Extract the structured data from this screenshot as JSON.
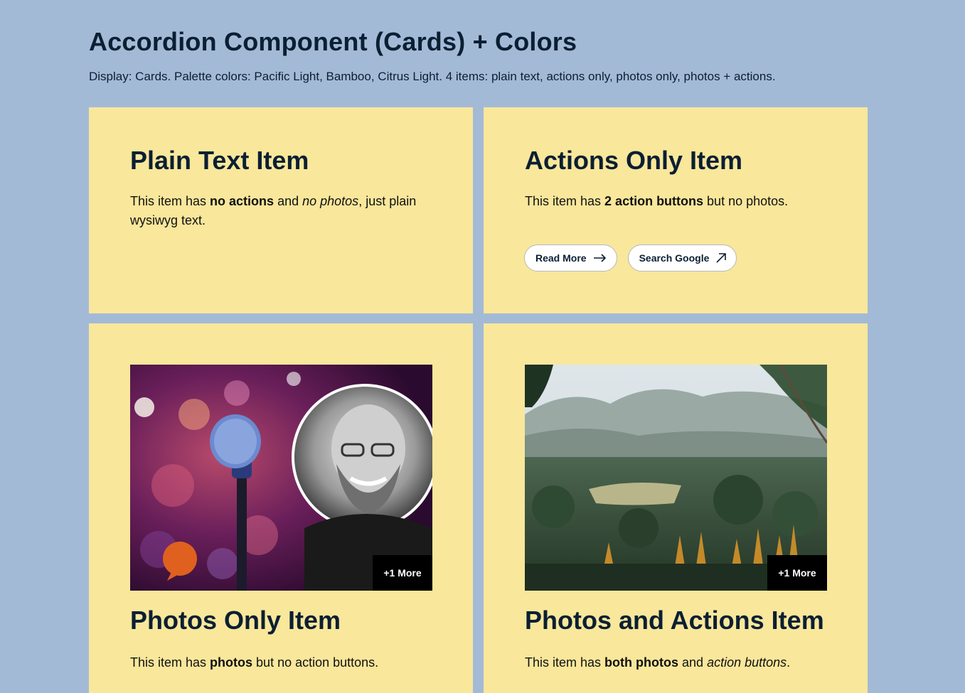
{
  "page": {
    "title": "Accordion Component (Cards) + Colors",
    "description": "Display: Cards. Palette colors: Pacific Light, Bamboo, Citrus Light. 4 items: plain text, actions only, photos only, photos + actions."
  },
  "colors": {
    "background": "#a3bad7",
    "card": "#f9e79b",
    "text": "#0b1f33",
    "badge": "#000000",
    "accent_orange": "#e0601f"
  },
  "cards": [
    {
      "title": "Plain Text Item",
      "body": {
        "p1": "This item has ",
        "b1": "no actions",
        "p2": " and ",
        "i1": "no photos",
        "p3": ", just plain wysiwyg text."
      }
    },
    {
      "title": "Actions Only Item",
      "body": {
        "p1": "This item has ",
        "b1": "2 action buttons",
        "p2": " but no photos."
      },
      "actions": [
        {
          "label": "Read More",
          "icon": "arrow-right-icon"
        },
        {
          "label": "Search Google",
          "icon": "external-link-icon"
        }
      ]
    },
    {
      "title": "Photos Only Item",
      "photo_badge": "+1 More",
      "body": {
        "p1": "This item has ",
        "b1": "photos",
        "p2": " but no action buttons."
      }
    },
    {
      "title": "Photos and Actions Item",
      "photo_badge": "+1 More",
      "body": {
        "p1": "This item has ",
        "b1": "both photos",
        "p2": " and ",
        "i1": "action buttons",
        "p3": "."
      }
    }
  ]
}
